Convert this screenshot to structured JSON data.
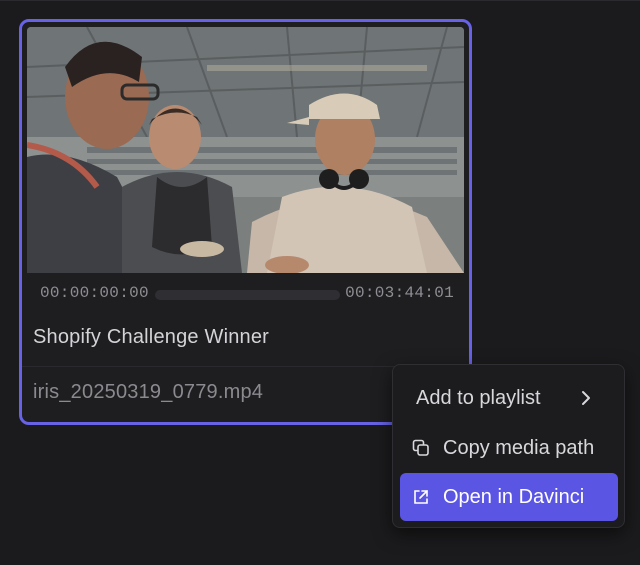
{
  "card": {
    "thumbnail_alt": "Video thumbnail",
    "time_start": "00:00:00:00",
    "time_end": "00:03:44:01",
    "progress": 0,
    "title": "Shopify Challenge Winner",
    "filename": "iris_20250319_0779.mp4",
    "accent_color": "#6762e6"
  },
  "context_menu": {
    "items": [
      {
        "label": "Add to playlist",
        "icon": "chevron-right-icon"
      },
      {
        "label": "Copy media path",
        "icon": "copy-icon"
      },
      {
        "label": "Open in Davinci",
        "icon": "external-link-icon",
        "highlighted": true
      }
    ],
    "highlight_color": "#5b55e3"
  }
}
